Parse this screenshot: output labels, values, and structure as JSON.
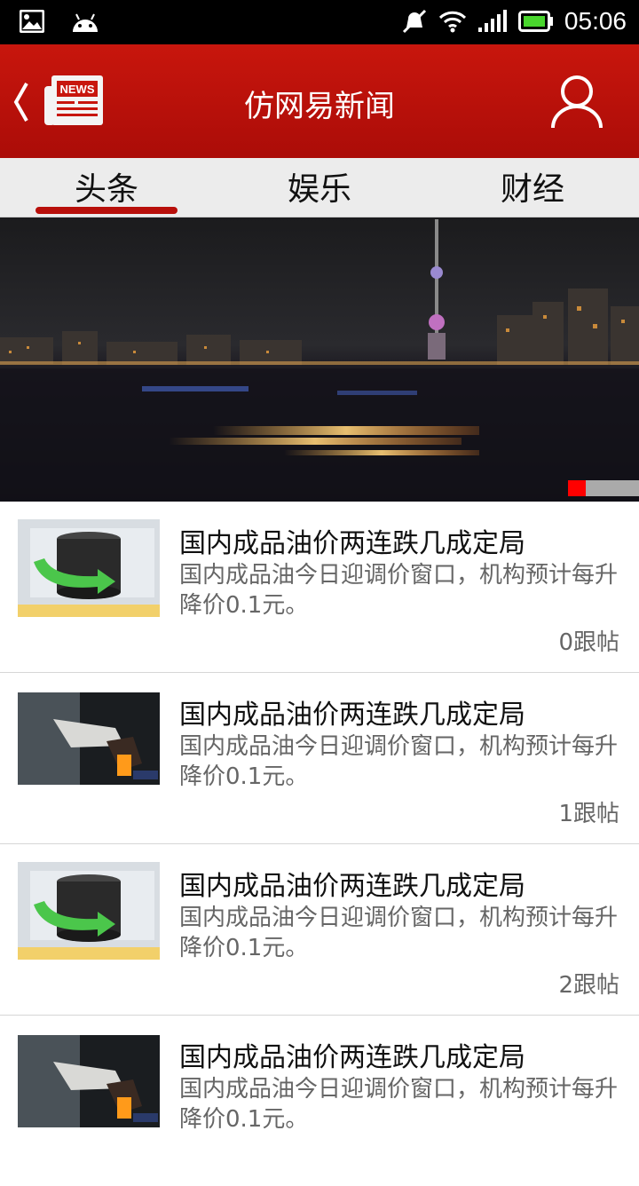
{
  "status": {
    "time": "05:06"
  },
  "app": {
    "title": "仿网易新闻",
    "logo_text": "NEWS"
  },
  "tabs": [
    {
      "label": "头条",
      "active": true
    },
    {
      "label": "娱乐"
    },
    {
      "label": "财经"
    }
  ],
  "banner": {
    "pages": 2,
    "current": 1
  },
  "news": [
    {
      "title": "国内成品油价两连跌几成定局",
      "desc": "国内成品油今日迎调价窗口，机构预计每升降价0.1元。",
      "count": "0跟帖",
      "thumb": "oil-barrel"
    },
    {
      "title": "国内成品油价两连跌几成定局",
      "desc": "国内成品油今日迎调价窗口，机构预计每升降价0.1元。",
      "count": "1跟帖",
      "thumb": "fuel-nozzle"
    },
    {
      "title": "国内成品油价两连跌几成定局",
      "desc": "国内成品油今日迎调价窗口，机构预计每升降价0.1元。",
      "count": "2跟帖",
      "thumb": "oil-barrel"
    },
    {
      "title": "国内成品油价两连跌几成定局",
      "desc": "国内成品油今日迎调价窗口，机构预计每升降价0.1元。",
      "count": "",
      "thumb": "fuel-nozzle"
    }
  ],
  "colors": {
    "brand": "#c8160d",
    "indicator": "#b80f0a",
    "status_bg": "#000000"
  }
}
